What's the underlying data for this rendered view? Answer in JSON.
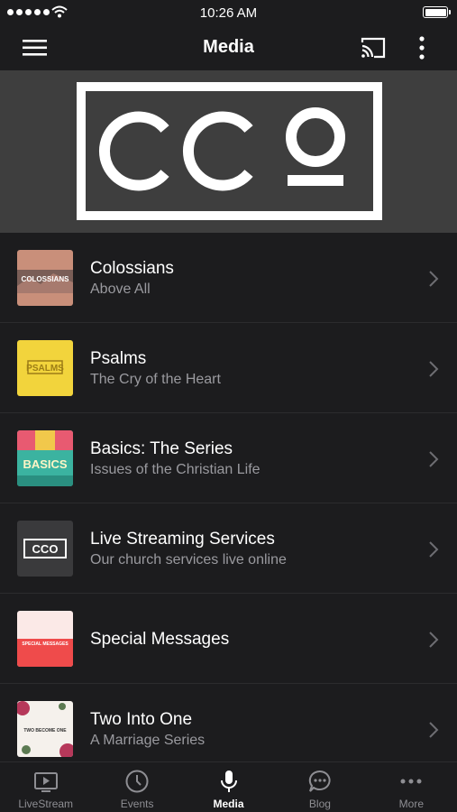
{
  "status_bar": {
    "time": "10:26 AM"
  },
  "nav": {
    "title": "Media",
    "menu_icon": "hamburger-menu-icon",
    "cast_icon": "cast-icon",
    "more_icon": "more-vertical-icon"
  },
  "banner": {
    "logo_text": "CCO"
  },
  "media_list": [
    {
      "title": "Colossians",
      "subtitle": "Above All",
      "thumb_text": "COLOSSIANS",
      "thumb_color": "#c98f7a"
    },
    {
      "title": "Psalms",
      "subtitle": "The Cry of the Heart",
      "thumb_text": "PSALMS",
      "thumb_color": "#f2d43c"
    },
    {
      "title": "Basics: The Series",
      "subtitle": "Issues of the Christian Life",
      "thumb_text": "BASICS",
      "thumb_color": "#3bb3a0"
    },
    {
      "title": "Live Streaming Services",
      "subtitle": "Our church services live online",
      "thumb_text": "CCO",
      "thumb_color": "#3a3a3c"
    },
    {
      "title": "Special Messages",
      "subtitle": "",
      "thumb_text": "SPECIAL MESSAGES",
      "thumb_color": "#ef4b4b"
    },
    {
      "title": "Two Into One",
      "subtitle": "A Marriage Series",
      "thumb_text": "TWO BECOME ONE",
      "thumb_color": "#f5f1ec"
    }
  ],
  "tabs": [
    {
      "label": "LiveStream",
      "icon": "tv-play-icon",
      "active": false
    },
    {
      "label": "Events",
      "icon": "clock-icon",
      "active": false
    },
    {
      "label": "Media",
      "icon": "microphone-icon",
      "active": true
    },
    {
      "label": "Blog",
      "icon": "chat-bubble-icon",
      "active": false
    },
    {
      "label": "More",
      "icon": "more-horizontal-icon",
      "active": false
    }
  ],
  "colors": {
    "background": "#1c1c1e",
    "banner": "#3e3e3e",
    "text_primary": "#ffffff",
    "text_secondary": "#9a9a9f",
    "tab_inactive": "#8e8e93",
    "separator": "#2c2c2e"
  }
}
